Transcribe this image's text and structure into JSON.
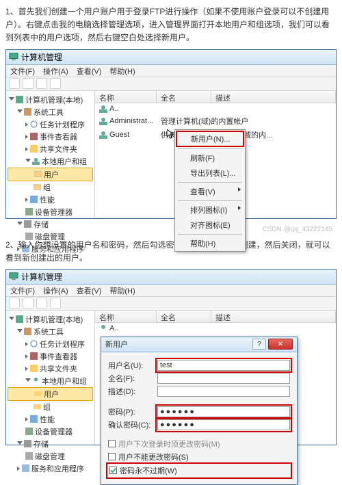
{
  "step1_text": "1、首先我们创建一个用户账户用于登录FTP进行操作（如果不使用账户登录可以不创建用户）。右键点击我的电脑选择管理选项，进入管理界面打开本地用户和组选项，我们可以看到列表中的用户选项，然后右键空白处选择新用户。",
  "step2_text": "2、输入你想设置的用户名和密码，然后勾选密码永不过期，点击创建，然后关闭，就可以看到新创建出的用户。",
  "watermark": "CSDN @qq_43222145",
  "window": {
    "title": "计算机管理",
    "menu": {
      "file": "文件(F)",
      "action": "操作(A)",
      "view": "查看(V)",
      "help": "帮助(H)"
    }
  },
  "tree": {
    "root": "计算机管理(本地)",
    "system_tools": "系统工具",
    "task_scheduler": "任务计划程序",
    "event_viewer": "事件查看器",
    "shared_folders": "共享文件夹",
    "local_users": "本地用户和组",
    "users": "用户",
    "groups": "组",
    "performance": "性能",
    "device_manager": "设备管理器",
    "storage": "存储",
    "disk_mgmt": "磁盘管理",
    "services": "服务和应用程序"
  },
  "list": {
    "col_name": "名称",
    "col_full": "全名",
    "col_desc": "描述",
    "rows": [
      {
        "name": "A..",
        "desc": ""
      },
      {
        "name": "Administrat...",
        "desc": "管理计算机(域)的内置帐户"
      },
      {
        "name": "Guest",
        "desc": "供来宾访问计算机或访问域的内..."
      }
    ]
  },
  "context": {
    "new_user": "新用户(N)...",
    "refresh": "刷新(F)",
    "export": "导出列表(L)...",
    "view": "查看(V)",
    "arrange": "排列图标(I)",
    "align": "对齐图标(E)",
    "help": "帮助(H)"
  },
  "dialog": {
    "title": "新用户",
    "username_lbl": "用户名(U):",
    "username_val": "test",
    "fullname_lbl": "全名(F):",
    "desc_lbl": "描述(D):",
    "password_lbl": "密码(P):",
    "password_val": "●●●●●●",
    "confirm_lbl": "确认密码(C):",
    "confirm_val": "●●●●●●",
    "chk_must_change": "用户下次登录时须更改密码(M)",
    "chk_cannot_change": "用户不能更改密码(S)",
    "chk_never_expire": "密码永不过期(W)"
  }
}
